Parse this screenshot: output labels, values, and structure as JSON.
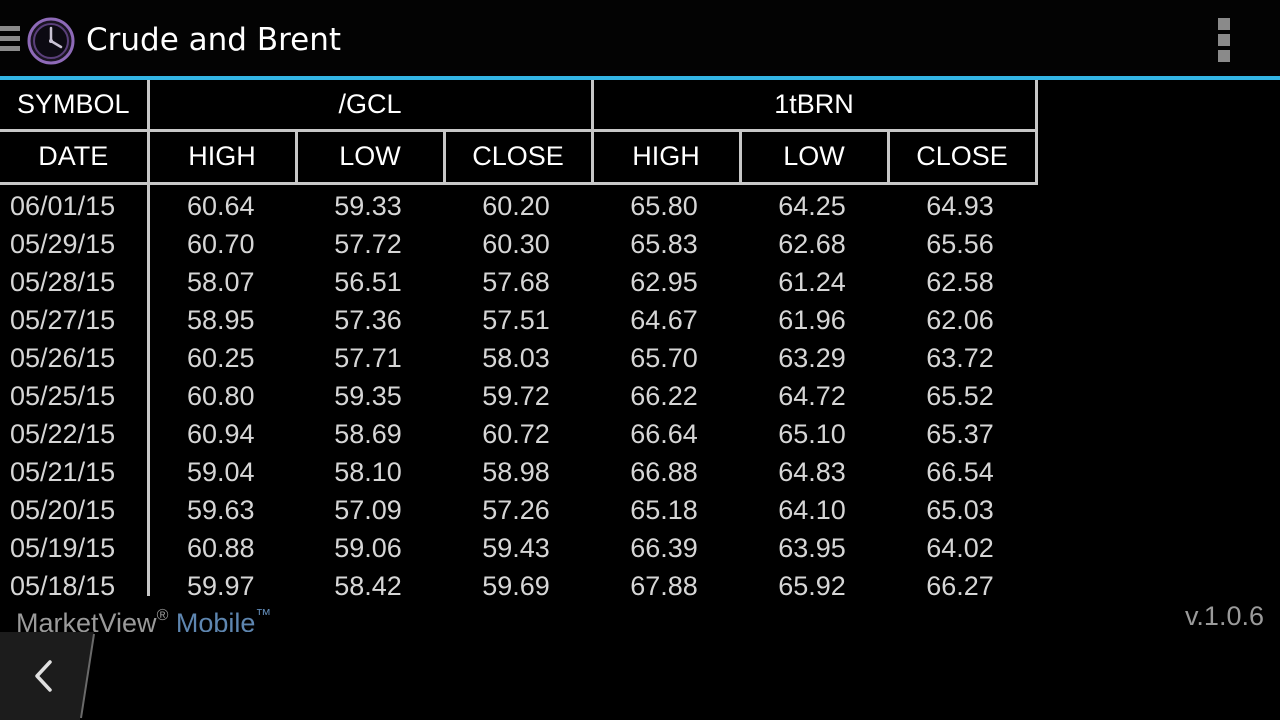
{
  "header": {
    "title": "Crude and Brent",
    "drawer_icon": "hamburger-icon",
    "app_icon": "clock-icon",
    "menu_icon": "overflow-menu-icon",
    "accent_color": "#33b5e5"
  },
  "table": {
    "symbol_label": "SYMBOL",
    "date_label": "DATE",
    "symbols": [
      "/GCL",
      "1tBRN"
    ],
    "column_labels": [
      "HIGH",
      "LOW",
      "CLOSE",
      "HIGH",
      "LOW",
      "CLOSE"
    ],
    "rows": [
      {
        "date": "06/01/15",
        "values": [
          "60.64",
          "59.33",
          "60.20",
          "65.80",
          "64.25",
          "64.93"
        ]
      },
      {
        "date": "05/29/15",
        "values": [
          "60.70",
          "57.72",
          "60.30",
          "65.83",
          "62.68",
          "65.56"
        ]
      },
      {
        "date": "05/28/15",
        "values": [
          "58.07",
          "56.51",
          "57.68",
          "62.95",
          "61.24",
          "62.58"
        ]
      },
      {
        "date": "05/27/15",
        "values": [
          "58.95",
          "57.36",
          "57.51",
          "64.67",
          "61.96",
          "62.06"
        ]
      },
      {
        "date": "05/26/15",
        "values": [
          "60.25",
          "57.71",
          "58.03",
          "65.70",
          "63.29",
          "63.72"
        ]
      },
      {
        "date": "05/25/15",
        "values": [
          "60.80",
          "59.35",
          "59.72",
          "66.22",
          "64.72",
          "65.52"
        ]
      },
      {
        "date": "05/22/15",
        "values": [
          "60.94",
          "58.69",
          "60.72",
          "66.64",
          "65.10",
          "65.37"
        ]
      },
      {
        "date": "05/21/15",
        "values": [
          "59.04",
          "58.10",
          "58.98",
          "66.88",
          "64.83",
          "66.54"
        ]
      },
      {
        "date": "05/20/15",
        "values": [
          "59.63",
          "57.09",
          "57.26",
          "65.18",
          "64.10",
          "65.03"
        ]
      },
      {
        "date": "05/19/15",
        "values": [
          "60.88",
          "59.06",
          "59.43",
          "66.39",
          "63.95",
          "64.02"
        ]
      },
      {
        "date": "05/18/15",
        "values": [
          "59.97",
          "58.42",
          "59.69",
          "67.88",
          "65.92",
          "66.27"
        ]
      }
    ]
  },
  "footer": {
    "brand_name": "MarketView",
    "brand_reg": "®",
    "brand_suffix": "Mobile",
    "brand_tm": "™",
    "version": "v.1.0.6",
    "brand_suffix_color": "#5e86b0"
  },
  "nav": {
    "back_icon": "back-icon"
  }
}
